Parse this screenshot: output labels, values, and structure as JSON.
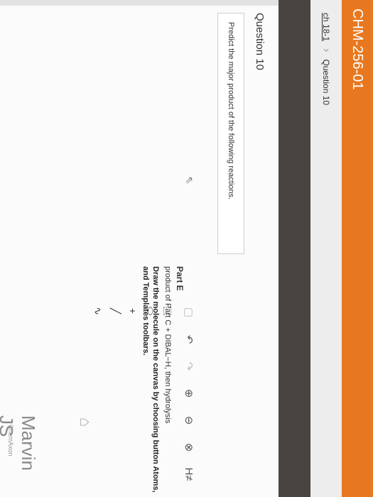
{
  "app": {
    "title": "CHM-256-01"
  },
  "breadcrumb": {
    "link": "ch 18-1",
    "current": "Question 10"
  },
  "question": {
    "title": "Question 10",
    "prompt": "Predict the major product of the following reactions."
  },
  "part": {
    "title": "Part E",
    "description": "product of Part C + DIBAL−H, then hydrolysis",
    "instruction": "Draw the molecule on the canvas by choosing button Atoms, and Templates toolbars."
  },
  "editor": {
    "brand": "Marvin JS",
    "vendor": "ChemAxon",
    "toolbar_icons": [
      "select-icon",
      "undo-icon",
      "redo-icon",
      "zoom-in-icon",
      "zoom-out-icon",
      "clear-icon",
      "hydrogen-label"
    ],
    "hydrogen_label": "H≠",
    "left_tools": [
      "selection-icon",
      "eraser-icon",
      "plus-icon",
      "single-bond-icon",
      "chain-icon",
      "ring-icon"
    ]
  }
}
